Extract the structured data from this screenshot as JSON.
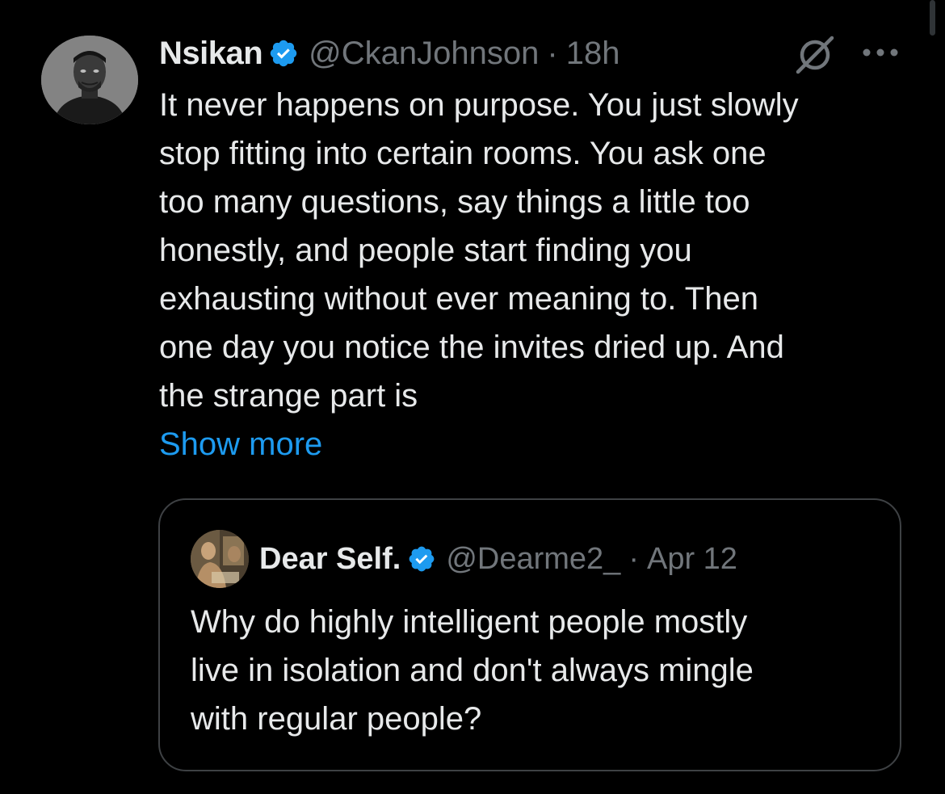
{
  "colors": {
    "background": "#000000",
    "text": "#e7e9ea",
    "secondary_text": "#71767b",
    "link": "#1d9bf0",
    "verified_badge": "#1d9bf0",
    "card_border": "#3e4144"
  },
  "tweet": {
    "author_name": "Nsikan",
    "handle": "@CkanJohnson",
    "separator": "·",
    "time": "18h",
    "verified": true,
    "text": "It never happens on purpose. You just slowly\nstop fitting into certain rooms. You ask one\ntoo many questions, say things a little too\nhonestly, and people start finding you\nexhausting without ever meaning to. Then\none day you notice the invites dried up. And\nthe strange part is",
    "show_more_label": "Show more",
    "icons": {
      "avatar": "profile-photo",
      "grok": "grok-icon",
      "more": "more-options-icon"
    }
  },
  "quoted_tweet": {
    "author_name": "Dear Self.",
    "handle": "@Dearme2_",
    "separator": "·",
    "time": "Apr 12",
    "verified": true,
    "text": "Why do highly intelligent people mostly\nlive in isolation and don't always mingle\nwith regular people?"
  }
}
